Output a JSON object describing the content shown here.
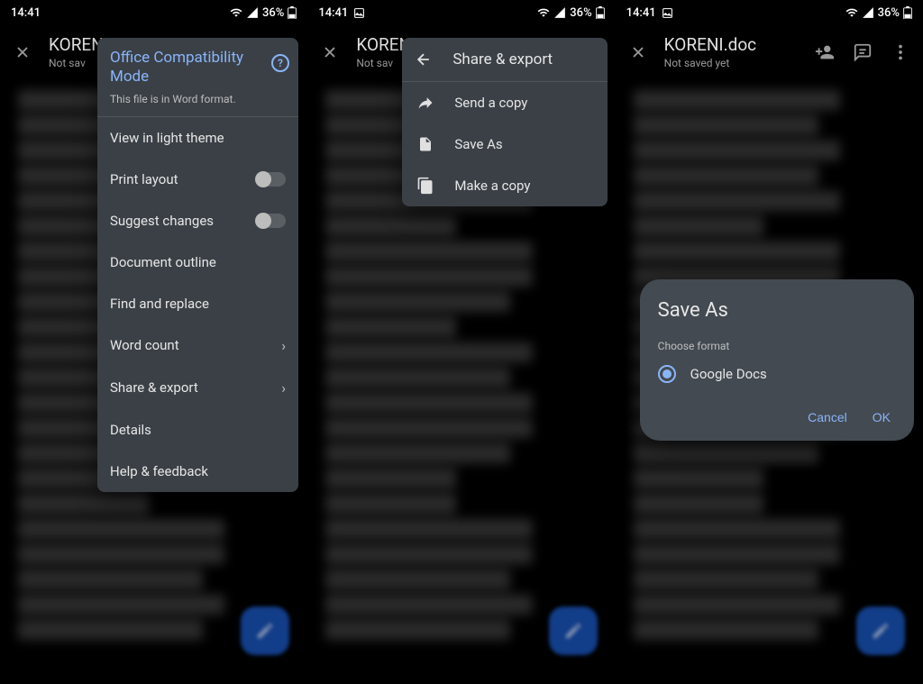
{
  "status": {
    "time": "14:41",
    "battery": "36%"
  },
  "doc": {
    "title_partial": "KOREN",
    "title_full": "KORENI.doc",
    "subtitle": "Not saved yet",
    "subtitle_partial": "Not sav"
  },
  "menu1": {
    "header_title": "Office Compatibility Mode",
    "header_sub": "This file is in Word format.",
    "items": {
      "view_light": "View in light theme",
      "print_layout": "Print layout",
      "suggest_changes": "Suggest changes",
      "doc_outline": "Document outline",
      "find_replace": "Find and replace",
      "word_count": "Word count",
      "share_export": "Share & export",
      "details": "Details",
      "help_feedback": "Help & feedback"
    }
  },
  "menu2": {
    "title": "Share & export",
    "items": {
      "send_copy": "Send a copy",
      "save_as": "Save As",
      "make_copy": "Make a copy"
    }
  },
  "dialog": {
    "title": "Save As",
    "label": "Choose format",
    "option": "Google Docs",
    "cancel": "Cancel",
    "ok": "OK"
  }
}
